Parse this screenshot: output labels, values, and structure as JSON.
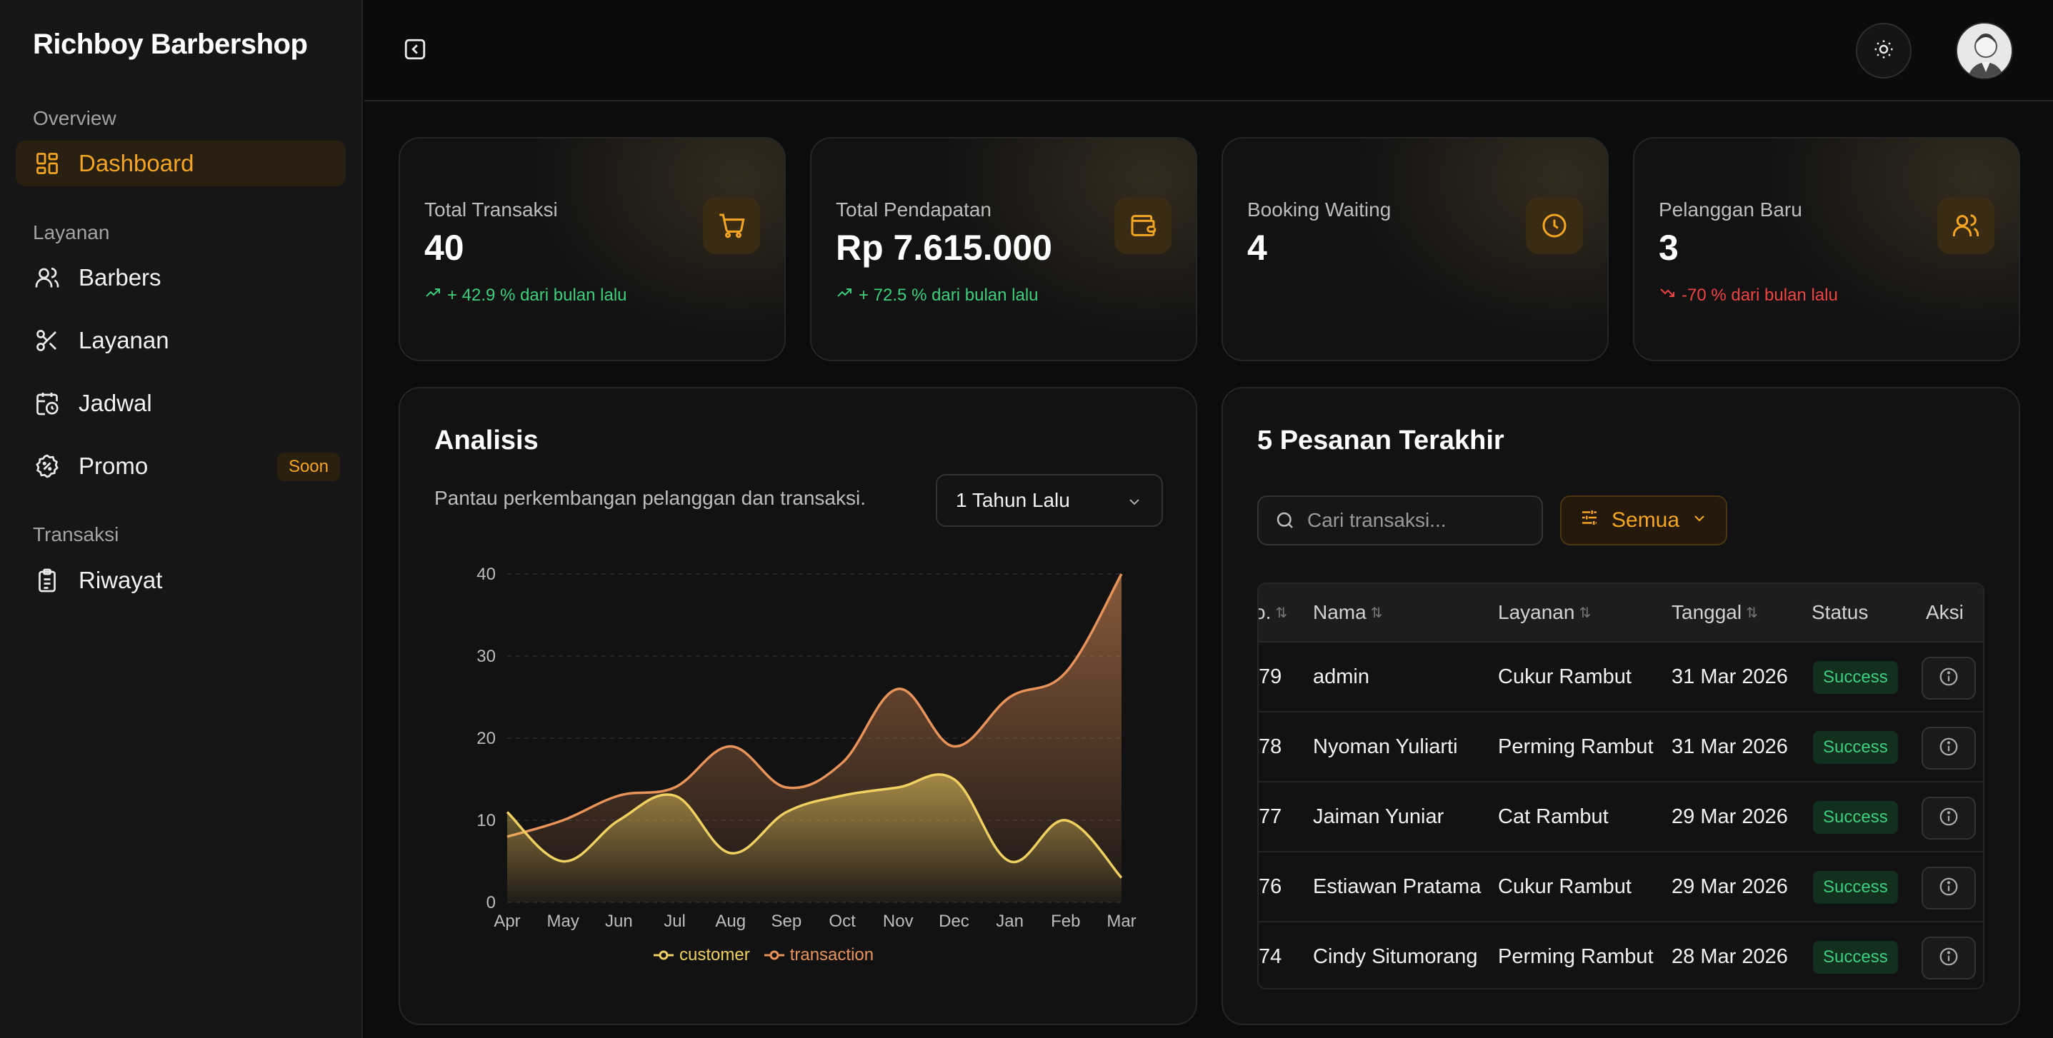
{
  "brand": "Richboy Barbershop",
  "sidebar": {
    "sections": [
      {
        "title": "Overview"
      },
      {
        "title": "Layanan"
      },
      {
        "title": "Transaksi"
      }
    ],
    "items": [
      {
        "label": "Dashboard",
        "icon": "dashboard-icon",
        "active": true
      },
      {
        "label": "Barbers",
        "icon": "users-icon"
      },
      {
        "label": "Layanan",
        "icon": "scissors-icon"
      },
      {
        "label": "Jadwal",
        "icon": "calendar-clock-icon"
      },
      {
        "label": "Promo",
        "icon": "percent-badge-icon",
        "badge": "Soon"
      },
      {
        "label": "Riwayat",
        "icon": "clipboard-icon"
      }
    ]
  },
  "topbar": {
    "collapse_icon": "sidebar-collapse-icon",
    "theme_icon": "sun-icon",
    "avatar_icon": "user-avatar"
  },
  "stats": [
    {
      "title": "Total Transaksi",
      "value": "40",
      "delta": "+ 42.9 % dari bulan lalu",
      "trend": "up",
      "icon": "cart-icon"
    },
    {
      "title": "Total Pendapatan",
      "value": "Rp 7.615.000",
      "delta": "+ 72.5 % dari bulan lalu",
      "trend": "up",
      "icon": "wallet-icon"
    },
    {
      "title": "Booking Waiting",
      "value": "4",
      "delta": "",
      "trend": "none",
      "icon": "clock-icon"
    },
    {
      "title": "Pelanggan Baru",
      "value": "3",
      "delta": "-70 % dari bulan lalu",
      "trend": "down",
      "icon": "users-icon"
    }
  ],
  "analysis": {
    "title": "Analisis",
    "subtitle": "Pantau perkembangan pelanggan dan transaksi.",
    "range_select": "1 Tahun Lalu"
  },
  "chart_data": {
    "type": "area",
    "categories": [
      "Apr",
      "May",
      "Jun",
      "Jul",
      "Aug",
      "Sep",
      "Oct",
      "Nov",
      "Dec",
      "Jan",
      "Feb",
      "Mar"
    ],
    "series": [
      {
        "name": "customer",
        "values": [
          11,
          5,
          10,
          13,
          6,
          11,
          13,
          14,
          15,
          5,
          10,
          3
        ],
        "color": "#f0d060"
      },
      {
        "name": "transaction",
        "values": [
          8,
          10,
          13,
          14,
          19,
          14,
          17,
          26,
          19,
          25,
          28,
          40
        ],
        "color": "#e8935a"
      }
    ],
    "yticks": [
      "0",
      "10",
      "20",
      "30",
      "40"
    ],
    "ylim": [
      0,
      40
    ],
    "grid": true,
    "legend_position": "bottom"
  },
  "orders": {
    "title": "5 Pesanan Terakhir",
    "search_placeholder": "Cari transaksi...",
    "filter_label": "Semua",
    "columns": [
      "o.",
      "Nama",
      "Layanan",
      "Tanggal",
      "Status",
      "Aksi"
    ],
    "rows": [
      {
        "no": "79",
        "nama": "admin",
        "layanan": "Cukur Rambut",
        "tanggal": "31 Mar 2026",
        "status": "Success"
      },
      {
        "no": "78",
        "nama": "Nyoman Yuliarti",
        "layanan": "Perming Rambut",
        "tanggal": "31 Mar 2026",
        "status": "Success"
      },
      {
        "no": "77",
        "nama": "Jaiman Yuniar",
        "layanan": "Cat Rambut",
        "tanggal": "29 Mar 2026",
        "status": "Success"
      },
      {
        "no": "76",
        "nama": "Estiawan Pratama",
        "layanan": "Cukur Rambut",
        "tanggal": "29 Mar 2026",
        "status": "Success"
      },
      {
        "no": "74",
        "nama": "Cindy Situmorang",
        "layanan": "Perming Rambut",
        "tanggal": "28 Mar 2026",
        "status": "Success"
      }
    ]
  }
}
